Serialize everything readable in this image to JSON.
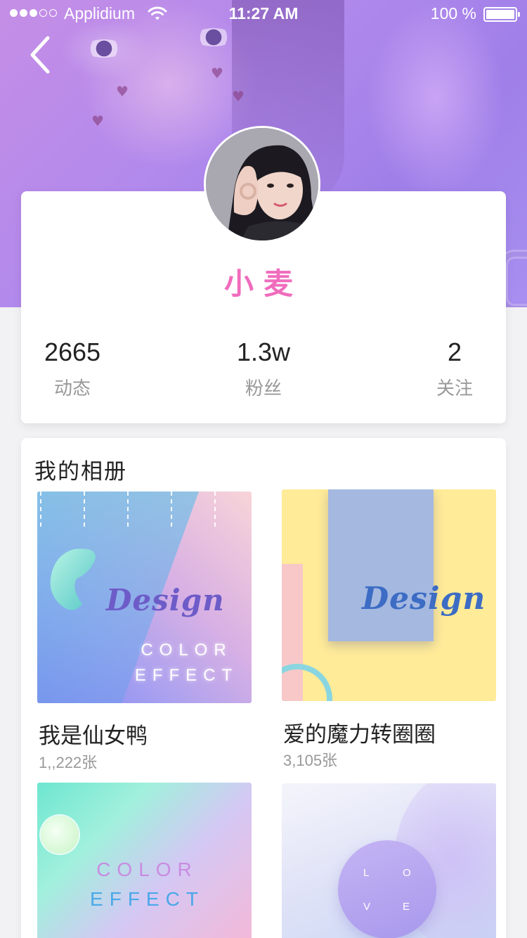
{
  "status_bar": {
    "carrier": "Applidium",
    "time": "11:27 AM",
    "battery": "100 %"
  },
  "profile": {
    "name": "小麦",
    "stats": [
      {
        "value": "2665",
        "label": "动态"
      },
      {
        "value": "1.3w",
        "label": "粉丝"
      },
      {
        "value": "2",
        "label": "关注"
      }
    ]
  },
  "albums": {
    "title": "我的相册",
    "items": [
      {
        "name": "我是仙女鸭",
        "count": "1,,222张"
      },
      {
        "name": "爱的魔力转圈圈",
        "count": "3,105张"
      }
    ]
  },
  "covers": {
    "c1_word": "Design",
    "c1_line1": "COLOR",
    "c1_line2": "EFFECT",
    "c2_word": "Design",
    "c3_line1": "COLOR",
    "c3_line2": "EFFECT",
    "c4_letters": [
      "L",
      "O",
      "V",
      "E"
    ]
  },
  "colors": {
    "accent_pink": "#f06cbd",
    "hero_purple": "#b189ec"
  },
  "icons": {
    "back": "chevron-left-icon",
    "wifi": "wifi-icon",
    "battery": "battery-icon"
  }
}
